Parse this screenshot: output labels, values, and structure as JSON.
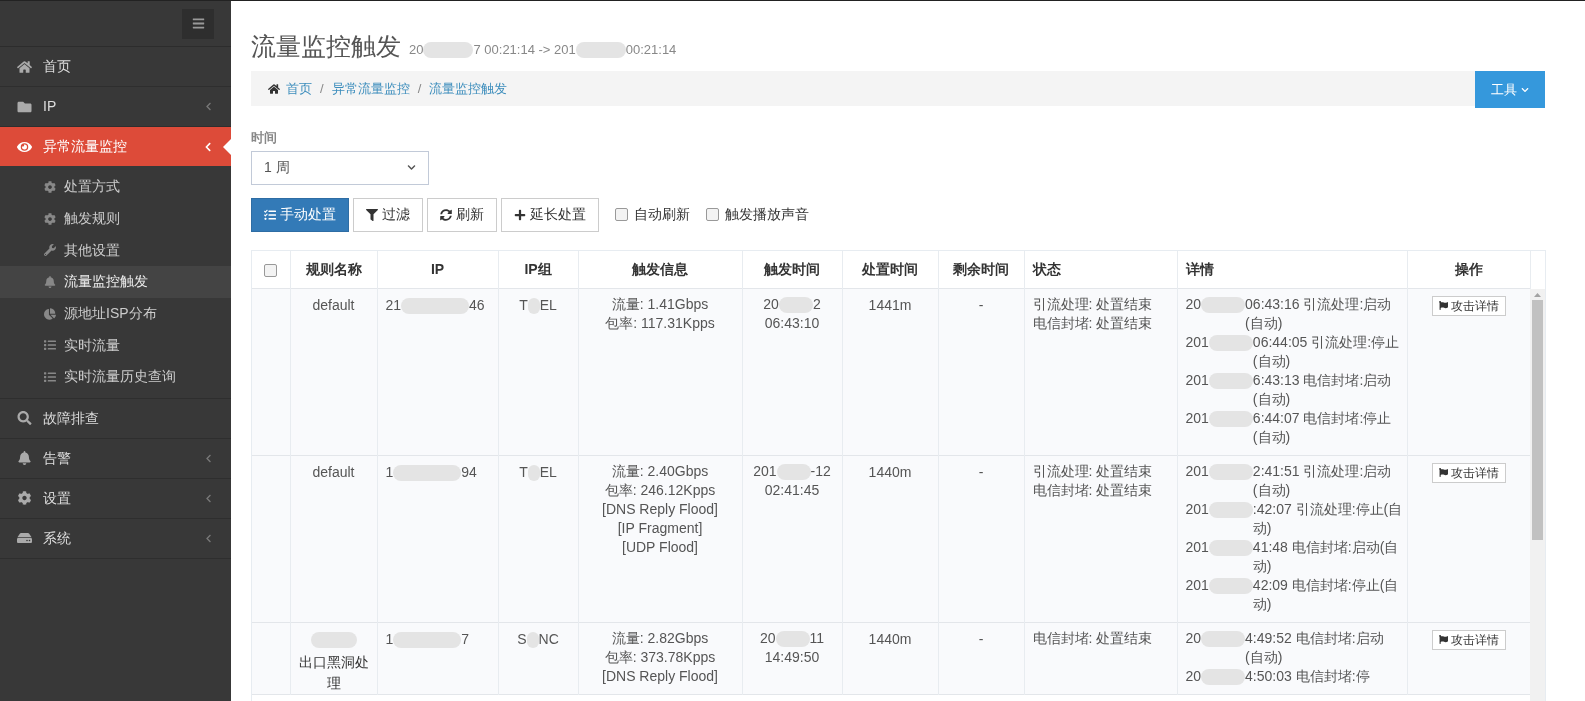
{
  "sidebar": {
    "items": [
      {
        "label": "首页",
        "has_caret": false,
        "selected": false
      },
      {
        "label": "IP",
        "expanded": false,
        "has_caret": true,
        "selected": false
      },
      {
        "label": "异常流量监控",
        "expanded": true,
        "has_caret": true,
        "selected": true,
        "children": [
          {
            "label": "处置方式",
            "selected": false
          },
          {
            "label": "触发规则",
            "selected": false
          },
          {
            "label": "其他设置",
            "selected": false
          },
          {
            "label": "流量监控触发",
            "selected": true
          },
          {
            "label": "源地址ISP分布",
            "selected": false
          },
          {
            "label": "实时流量",
            "selected": false
          },
          {
            "label": "实时流量历史查询",
            "selected": false
          }
        ]
      },
      {
        "label": "故障排查",
        "has_caret": false,
        "selected": false
      },
      {
        "label": "告警",
        "expanded": false,
        "has_caret": true,
        "selected": false
      },
      {
        "label": "设置",
        "expanded": false,
        "has_caret": true,
        "selected": false
      },
      {
        "label": "系统",
        "expanded": false,
        "has_caret": true,
        "selected": false
      }
    ]
  },
  "page": {
    "title": "流量监控触发",
    "subtitle": [
      "20",
      "7 00:21:14 -> 201",
      "00:21:14"
    ]
  },
  "breadcrumb": [
    {
      "kind": "link",
      "text": "首页"
    },
    {
      "kind": "separator",
      "text": "/"
    },
    {
      "kind": "link",
      "text": "异常流量监控"
    },
    {
      "kind": "separator",
      "text": "/"
    },
    {
      "kind": "link",
      "text": "流量监控触发"
    }
  ],
  "tools_button": "工具",
  "time_filter": {
    "label": "时间",
    "value": "1 周"
  },
  "toolbar": {
    "buttons": [
      {
        "label": "手动处置",
        "primary": true
      },
      {
        "label": "过滤",
        "primary": false
      },
      {
        "label": "刷新",
        "primary": false
      },
      {
        "label": "延长处置",
        "primary": false
      }
    ],
    "checkboxes": [
      {
        "label": "自动刷新",
        "checked": false
      },
      {
        "label": "触发播放声音",
        "checked": false
      }
    ]
  },
  "table": {
    "select_all": false,
    "columns": [
      "规则名称",
      "IP",
      "IP组",
      "触发信息",
      "触发时间",
      "处置时间",
      "剩余时间",
      "状态",
      "详情",
      "操作"
    ],
    "rows": [
      {
        "rule": {
          "redacted": false,
          "text": "default"
        },
        "ip": [
          "21",
          "46"
        ],
        "group": [
          "T",
          "EL"
        ],
        "info": [
          "流量: 1.41Gbps",
          "包率: 117.31Kpps"
        ],
        "trigger_time": [
          [
            "20",
            "2"
          ],
          [
            "06:43:10"
          ]
        ],
        "handle_time": "1441m",
        "remaining": "-",
        "status": [
          "引流处理: 处置结束",
          "电信封堵: 处置结束"
        ],
        "details": [
          [
            "20",
            "06:43:16 引流处理:启动(自动)"
          ],
          [
            "201",
            "06:44:05 引流处理:停止(自动)"
          ],
          [
            "201",
            "6:43:13 电信封堵:启动(自动)"
          ],
          [
            "201",
            "6:44:07 电信封堵:停止(自动)"
          ]
        ],
        "action": "攻击详情"
      },
      {
        "rule": {
          "redacted": false,
          "text": "default"
        },
        "ip": [
          "1",
          "94"
        ],
        "group": [
          "T",
          "EL"
        ],
        "info": [
          "流量: 2.40Gbps",
          "包率: 246.12Kpps",
          "[DNS Reply Flood]",
          "[IP Fragment]",
          "[UDP Flood]"
        ],
        "trigger_time": [
          [
            "201",
            "-12"
          ],
          [
            "02:41:45"
          ]
        ],
        "handle_time": "1440m",
        "remaining": "-",
        "status": [
          "引流处理: 处置结束",
          "电信封堵: 处置结束"
        ],
        "details": [
          [
            "201",
            "2:41:51 引流处理:启动(自动)"
          ],
          [
            "201",
            ":42:07 引流处理:停止(自动)"
          ],
          [
            "201",
            "41:48 电信封堵:启动(自动)"
          ],
          [
            "201",
            "42:09 电信封堵:停止(自动)"
          ]
        ],
        "action": "攻击详情"
      },
      {
        "rule": {
          "redacted": true,
          "text": "出口黑洞处理"
        },
        "ip": [
          "1",
          "7"
        ],
        "group": [
          "S",
          "NC"
        ],
        "info": [
          "流量: 2.82Gbps",
          "包率: 373.78Kpps",
          "[DNS Reply Flood]"
        ],
        "trigger_time": [
          [
            "20",
            "11"
          ],
          [
            "14:49:50"
          ]
        ],
        "handle_time": "1440m",
        "remaining": "-",
        "status": [
          "电信封堵: 处置结束"
        ],
        "details": [
          [
            "20",
            "4:49:52 电信封堵:启动(自动)"
          ],
          [
            "20",
            "4:50:03 电信封堵:停"
          ]
        ],
        "action": "攻击详情"
      }
    ]
  }
}
